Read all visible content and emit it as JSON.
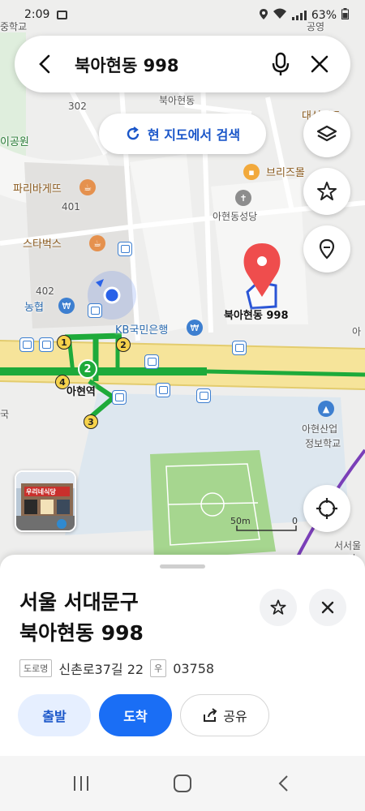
{
  "status_bar": {
    "time": "2:09",
    "battery": "63%"
  },
  "search": {
    "query": "북아현동 998"
  },
  "area_search": {
    "label": "현 지도에서 검색"
  },
  "map": {
    "labels": {
      "school_top": "중학교",
      "gongyeong": "공영",
      "num_302": "302",
      "bukahyeondong": "북아현동",
      "daeseong": "대성맨드",
      "park": "이공원",
      "paris": "파리바게뜨",
      "num_401": "401",
      "breeze": "브리즈몰",
      "church": "아현동성당",
      "starbucks": "스타벅스",
      "num_402": "402",
      "nonghyup": "농협",
      "kb": "KB국민은행",
      "ahyeon_station": "아현역",
      "school_bottom_1": "아현산업",
      "school_bottom_2": "정보학교",
      "left_edge": "국",
      "right_edge_1": "서서울",
      "right_edge_2": "아",
      "right_a": "아",
      "scale_label": "50m",
      "scale_zero": "0",
      "marker_label": "북아현동 998",
      "thumb_sign": "우리네식당"
    },
    "exits": [
      "1",
      "2",
      "3",
      "4"
    ],
    "line_badge": "2"
  },
  "place": {
    "title_line1": "서울 서대문구",
    "title_line2": "북아현동 998",
    "road_tag": "도로명",
    "road_address": "신촌로37길 22",
    "zip_tag": "우",
    "zip": "03758"
  },
  "actions": {
    "depart": "출발",
    "arrive": "도착",
    "share": "공유"
  },
  "colors": {
    "accent_blue": "#1a6ef5",
    "marker_red": "#ef4d4d",
    "subway_green": "#1eaa3a",
    "road_yellow": "#f6e49a"
  }
}
